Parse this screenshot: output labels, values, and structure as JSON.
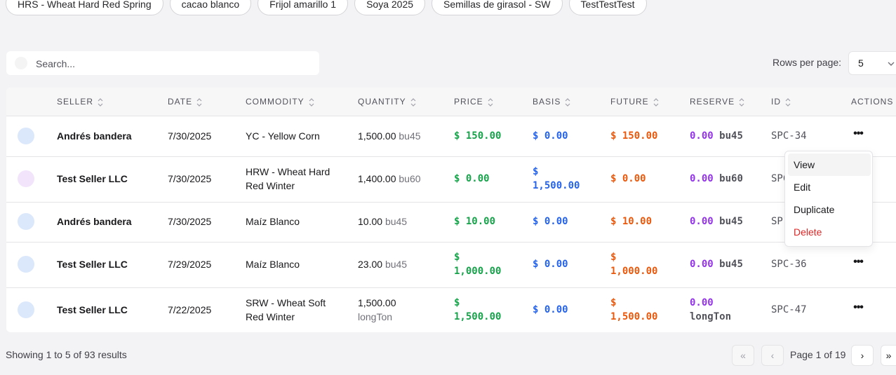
{
  "filter_chips": [
    "HRS - Wheat Hard Red Spring",
    "cacao blanco",
    "Frijol amarillo 1",
    "Soya 2025",
    "Semillas de girasol - SW",
    "TestTestTest"
  ],
  "search": {
    "placeholder": "Search...",
    "value": ""
  },
  "rows_per_page": {
    "label": "Rows per page:",
    "value": "5"
  },
  "table": {
    "columns": [
      "SELLER",
      "DATE",
      "COMMODITY",
      "QUANTITY",
      "PRICE",
      "BASIS",
      "FUTURE",
      "RESERVE",
      "ID",
      "ACTIONS"
    ],
    "rows": [
      {
        "avatar_color": "#dbe7fb",
        "seller": "Andrés bandera",
        "date": "7/30/2025",
        "commodity": [
          "YC - Yellow Corn"
        ],
        "quantity": "1,500.00",
        "quantity_unit": "bu45",
        "price": [
          "$ 150.00"
        ],
        "basis": [
          "$ 0.00"
        ],
        "future": [
          "$ 150.00"
        ],
        "reserve": "0.00",
        "reserve_unit": "bu45",
        "id": "SPC-34"
      },
      {
        "avatar_color": "#f1e4fb",
        "seller": "Test Seller LLC",
        "date": "7/30/2025",
        "commodity": [
          "HRW - Wheat Hard",
          "Red Winter"
        ],
        "quantity": "1,400.00",
        "quantity_unit": "bu60",
        "price": [
          "$ 0.00"
        ],
        "basis": [
          "$",
          "1,500.00"
        ],
        "future": [
          "$ 0.00"
        ],
        "reserve": "0.00",
        "reserve_unit": "bu60",
        "id": "SPC"
      },
      {
        "avatar_color": "#dbe7fb",
        "seller": "Andrés bandera",
        "date": "7/30/2025",
        "commodity": [
          "Maíz Blanco"
        ],
        "quantity": "10.00",
        "quantity_unit": "bu45",
        "price": [
          "$ 10.00"
        ],
        "basis": [
          "$ 0.00"
        ],
        "future": [
          "$ 10.00"
        ],
        "reserve": "0.00",
        "reserve_unit": "bu45",
        "id": "SP"
      },
      {
        "avatar_color": "#dbe7fb",
        "seller": "Test Seller LLC",
        "date": "7/29/2025",
        "commodity": [
          "Maíz Blanco"
        ],
        "quantity": "23.00",
        "quantity_unit": "bu45",
        "price": [
          "$",
          "1,000.00"
        ],
        "basis": [
          "$ 0.00"
        ],
        "future": [
          "$",
          "1,000.00"
        ],
        "reserve": "0.00",
        "reserve_unit": "bu45",
        "id": "SPC-36"
      },
      {
        "avatar_color": "#dbe7fb",
        "seller": "Test Seller LLC",
        "date": "7/22/2025",
        "commodity": [
          "SRW - Wheat Soft",
          "Red Winter"
        ],
        "quantity": "1,500.00",
        "quantity_unit": "longTon",
        "price": [
          "$",
          "1,500.00"
        ],
        "basis": [
          "$ 0.00"
        ],
        "future": [
          "$",
          "1,500.00"
        ],
        "reserve": "0.00",
        "reserve_unit": "longTon",
        "id": "SPC-47"
      }
    ]
  },
  "actions_menu": {
    "items": [
      "View",
      "Edit",
      "Duplicate",
      "Delete"
    ],
    "highlighted": "View"
  },
  "pagination": {
    "summary": "Showing 1 to 5 of 93 results",
    "page_info": "Page 1 of 19",
    "first_icon": "«",
    "prev_icon": "‹",
    "next_icon": "›",
    "last_icon": "»"
  },
  "colors": {
    "price": "#16a34a",
    "basis": "#2563eb",
    "future": "#ea580c",
    "reserve": "#9333ea",
    "danger": "#dc2626"
  }
}
